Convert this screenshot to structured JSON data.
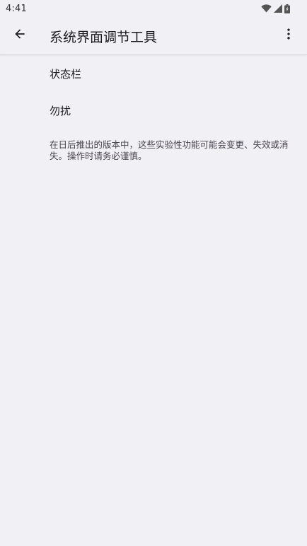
{
  "status_bar": {
    "time": "4:41",
    "icons": [
      "wifi-icon",
      "cellular-signal-icon",
      "battery-icon"
    ]
  },
  "app_bar": {
    "back_icon": "arrow-left-icon",
    "title": "系统界面调节工具",
    "overflow_icon": "more-vert-icon"
  },
  "list": {
    "items": [
      {
        "label": "状态栏"
      },
      {
        "label": "勿扰"
      }
    ],
    "footer_note": "在日后推出的版本中，这些实验性功能可能会变更、失效或消失。操作时请务必谨慎。"
  },
  "colors": {
    "background": "#f1f0f5",
    "text_primary": "#1c1b1f",
    "text_secondary": "#49454f"
  }
}
